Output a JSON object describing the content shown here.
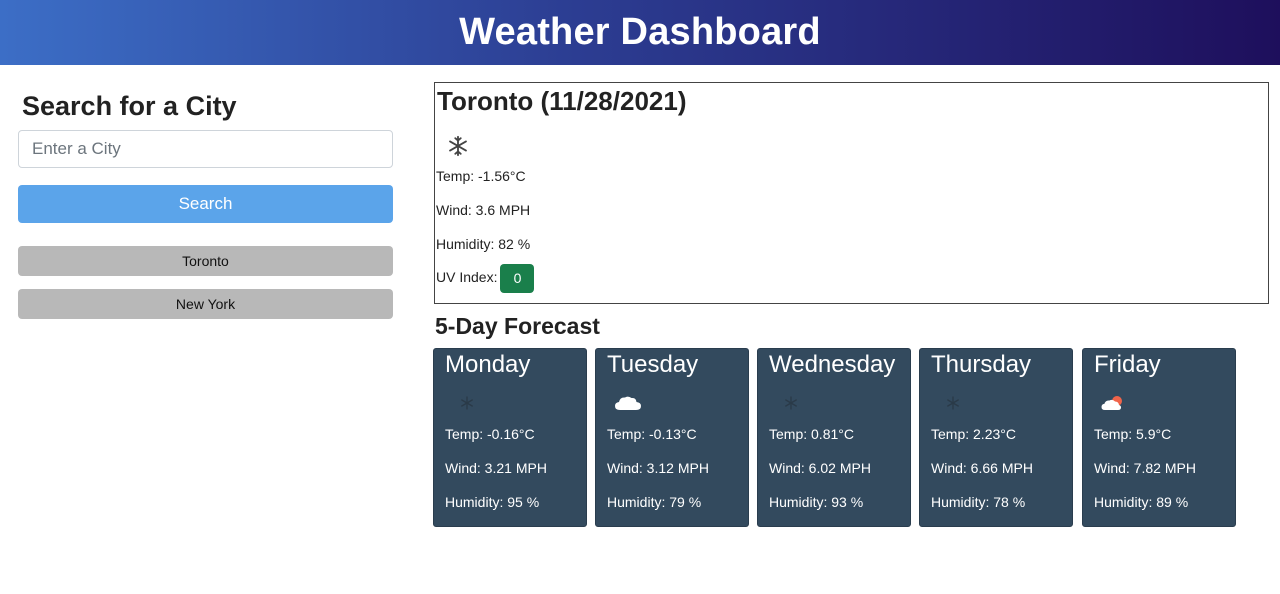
{
  "header": {
    "title": "Weather Dashboard"
  },
  "search": {
    "heading": "Search for a City",
    "placeholder": "Enter a City",
    "button_label": "Search",
    "history": [
      "Toronto",
      "New York"
    ]
  },
  "current": {
    "title": "Toronto (11/28/2021)",
    "icon": "snow-icon",
    "temp": "Temp: -1.56°C",
    "wind": "Wind: 3.6 MPH",
    "humidity": "Humidity: 82 %",
    "uv_label": "UV Index:",
    "uv_value": "0",
    "uv_color": "#1a7f4b"
  },
  "forecast": {
    "title": "5-Day Forecast",
    "days": [
      {
        "day": "Monday",
        "icon": "snow-icon",
        "temp": "Temp: -0.16°C",
        "wind": "Wind: 3.21 MPH",
        "humidity": "Humidity: 95 %"
      },
      {
        "day": "Tuesday",
        "icon": "cloud-icon",
        "temp": "Temp: -0.13°C",
        "wind": "Wind: 3.12 MPH",
        "humidity": "Humidity: 79 %"
      },
      {
        "day": "Wednesday",
        "icon": "snow-icon",
        "temp": "Temp: 0.81°C",
        "wind": "Wind: 6.02 MPH",
        "humidity": "Humidity: 93 %"
      },
      {
        "day": "Thursday",
        "icon": "snow-icon",
        "temp": "Temp: 2.23°C",
        "wind": "Wind: 6.66 MPH",
        "humidity": "Humidity: 78 %"
      },
      {
        "day": "Friday",
        "icon": "partly-cloudy-icon",
        "temp": "Temp: 5.9°C",
        "wind": "Wind: 7.82 MPH",
        "humidity": "Humidity: 89 %"
      }
    ]
  },
  "colors": {
    "header_start": "#3c6ec6",
    "header_end": "#1e0f5c",
    "search_button": "#5ba4ea",
    "history_button": "#b8b8b8",
    "card_bg": "#334a5e"
  }
}
